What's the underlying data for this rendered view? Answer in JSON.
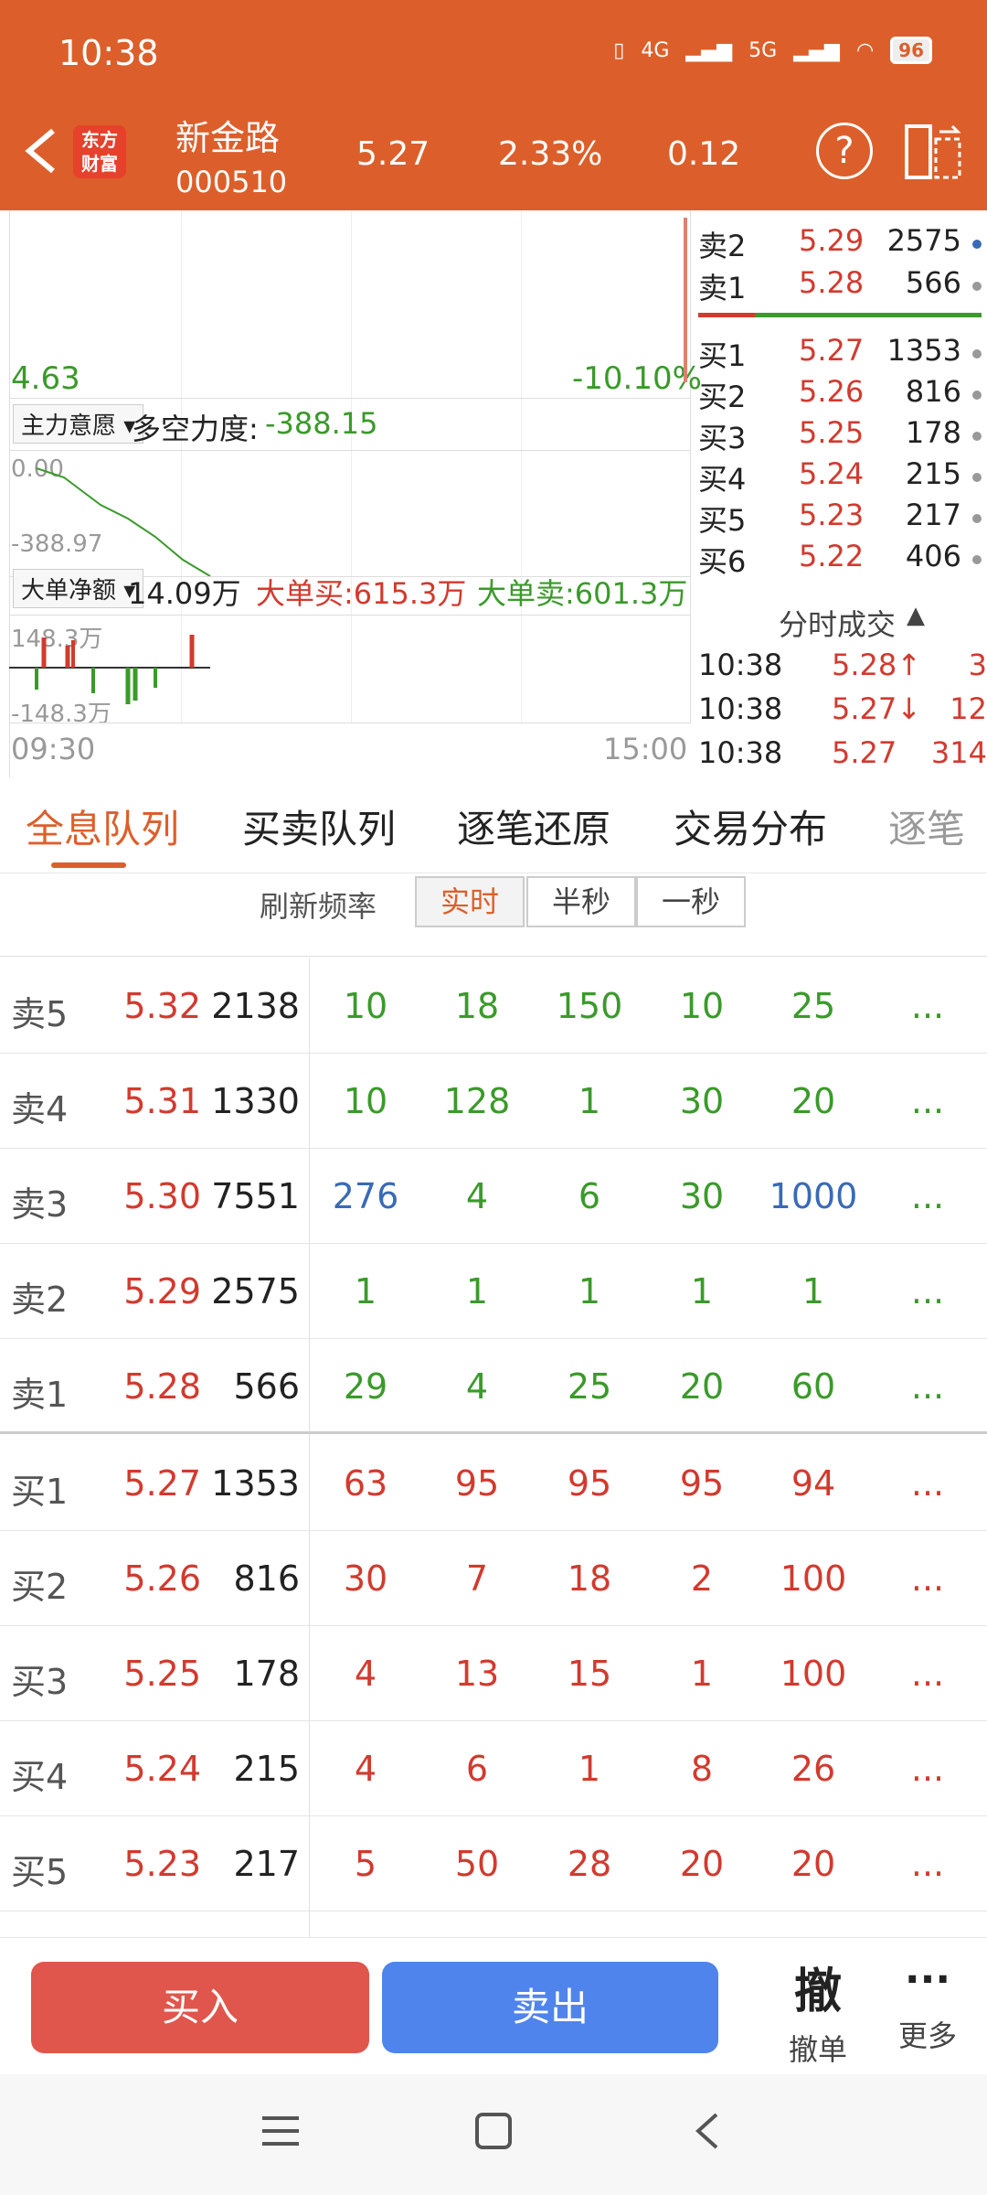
{
  "status": {
    "time": "10:38",
    "net1": "4G",
    "net2": "5G",
    "battery": "96"
  },
  "header": {
    "name": "新金路",
    "code": "000510",
    "price": "5.27",
    "pct": "2.33%",
    "change": "0.12",
    "logo1": "东方",
    "logo2": "财富"
  },
  "chart": {
    "low_price": "4.63",
    "low_pct": "-10.10%",
    "ind1_tag": "主力意愿",
    "ind1_label": "多空力度:",
    "ind1_val": "-388.15",
    "ind1_top": "0.00",
    "ind1_bot": "-388.97",
    "ind2_tag": "大单净额",
    "ind2_val": "14.09万",
    "ind2_buy": "大单买:615.3万",
    "ind2_sell": "大单卖:601.3万",
    "ind2_top": "148.3万",
    "ind2_bot": "-148.3万",
    "t_start": "09:30",
    "t_end": "15:00"
  },
  "orderbook": {
    "asks": [
      {
        "label": "卖2",
        "price": "5.29",
        "vol": "2575"
      },
      {
        "label": "卖1",
        "price": "5.28",
        "vol": "566"
      }
    ],
    "bids": [
      {
        "label": "买1",
        "price": "5.27",
        "vol": "1353"
      },
      {
        "label": "买2",
        "price": "5.26",
        "vol": "816"
      },
      {
        "label": "买3",
        "price": "5.25",
        "vol": "178"
      },
      {
        "label": "买4",
        "price": "5.24",
        "vol": "215"
      },
      {
        "label": "买5",
        "price": "5.23",
        "vol": "217"
      },
      {
        "label": "买6",
        "price": "5.22",
        "vol": "406"
      }
    ],
    "ticks_title": "分时成交",
    "ticks": [
      {
        "time": "10:38",
        "price": "5.28↑",
        "vol": "3"
      },
      {
        "time": "10:38",
        "price": "5.27↓",
        "vol": "12"
      },
      {
        "time": "10:38",
        "price": "5.27",
        "vol": "314"
      }
    ]
  },
  "tabs": [
    "全息队列",
    "买卖队列",
    "逐笔还原",
    "交易分布",
    "逐笔"
  ],
  "refresh": {
    "label": "刷新频率",
    "opts": [
      "实时",
      "半秒",
      "一秒"
    ]
  },
  "queue": [
    {
      "label": "卖5",
      "price": "5.32",
      "vol": "2138",
      "q": [
        "10",
        "18",
        "150",
        "10",
        "25"
      ],
      "more": "..."
    },
    {
      "label": "卖4",
      "price": "5.31",
      "vol": "1330",
      "q": [
        "10",
        "128",
        "1",
        "30",
        "20"
      ],
      "more": "..."
    },
    {
      "label": "卖3",
      "price": "5.30",
      "vol": "7551",
      "q": [
        "276",
        "4",
        "6",
        "30",
        "1000"
      ],
      "more": "..."
    },
    {
      "label": "卖2",
      "price": "5.29",
      "vol": "2575",
      "q": [
        "1",
        "1",
        "1",
        "1",
        "1"
      ],
      "more": "..."
    },
    {
      "label": "卖1",
      "price": "5.28",
      "vol": "566",
      "q": [
        "29",
        "4",
        "25",
        "20",
        "60"
      ],
      "more": "..."
    },
    {
      "label": "买1",
      "price": "5.27",
      "vol": "1353",
      "q": [
        "63",
        "95",
        "95",
        "95",
        "94"
      ],
      "more": "..."
    },
    {
      "label": "买2",
      "price": "5.26",
      "vol": "816",
      "q": [
        "30",
        "7",
        "18",
        "2",
        "100"
      ],
      "more": "..."
    },
    {
      "label": "买3",
      "price": "5.25",
      "vol": "178",
      "q": [
        "4",
        "13",
        "15",
        "1",
        "100"
      ],
      "more": "..."
    },
    {
      "label": "买4",
      "price": "5.24",
      "vol": "215",
      "q": [
        "4",
        "6",
        "1",
        "8",
        "26"
      ],
      "more": "..."
    },
    {
      "label": "买5",
      "price": "5.23",
      "vol": "217",
      "q": [
        "5",
        "50",
        "28",
        "20",
        "20"
      ],
      "more": "..."
    }
  ],
  "bottom": {
    "buy": "买入",
    "sell": "卖出",
    "cancel_icon": "撤",
    "cancel": "撤单",
    "more": "更多"
  }
}
